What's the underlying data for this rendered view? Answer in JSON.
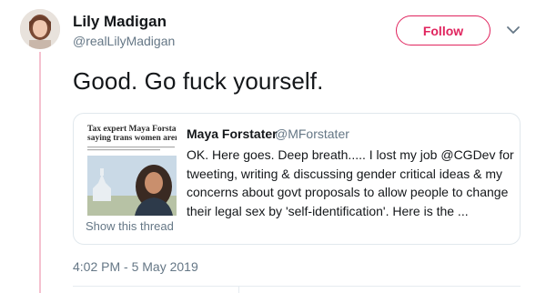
{
  "tweet": {
    "author_name": "Lily Madigan",
    "author_handle": "@realLilyMadigan",
    "follow_label": "Follow",
    "text": "Good. Go fuck yourself.",
    "timestamp": "4:02 PM - 5 May 2019"
  },
  "quoted": {
    "author_name": "Maya Forstater",
    "author_handle": "@MForstater",
    "text": "OK. Here goes. Deep breath..... I lost my job @CGDev for tweeting, writing & discussing gender critical ideas & my concerns about govt proposals to allow people to change their legal sex by 'self-identification'. Here is the ...",
    "show_thread_label": "Show this thread",
    "thumbnail_headline_1": "Tax expert Maya Forstater fir",
    "thumbnail_headline_2": "saying trans women aren't wo"
  },
  "colors": {
    "accent_follow": "#e0245e",
    "thread_line": "#f5c1cf",
    "secondary_text": "#657786",
    "border": "#e1e8ed"
  },
  "icons": {
    "menu": "chevron-down-icon"
  }
}
